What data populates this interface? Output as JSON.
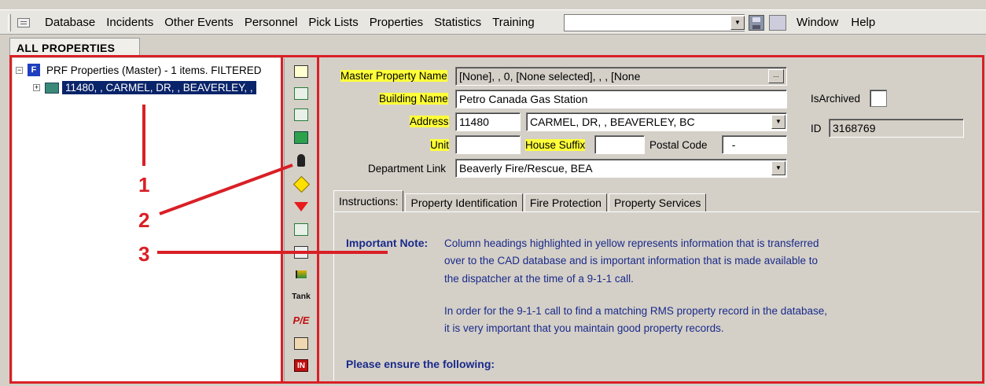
{
  "menubar": {
    "items": [
      "Database",
      "Incidents",
      "Other Events",
      "Personnel",
      "Pick Lists",
      "Properties",
      "Statistics",
      "Training"
    ],
    "combo_value": "",
    "right_items": [
      "Window",
      "Help"
    ]
  },
  "tab": {
    "label": "ALL PROPERTIES"
  },
  "tree": {
    "root_label": "PRF  Properties (Master) - 1 items. FILTERED",
    "child_label": "11480, , CARMEL, DR, , BEAVERLEY, ,"
  },
  "toolbar": {
    "tools": [
      {
        "name": "up-folder-icon"
      },
      {
        "name": "green-building-up-icon"
      },
      {
        "name": "green-building-down-icon"
      },
      {
        "name": "green-house-icon"
      },
      {
        "name": "person-icon"
      },
      {
        "name": "hydrant-diamond-icon"
      },
      {
        "name": "red-triangle-icon"
      },
      {
        "name": "al-box-icon"
      },
      {
        "name": "document-icon"
      },
      {
        "name": "flag-icon"
      },
      {
        "name": "tank-icon",
        "label": "Tank"
      },
      {
        "name": "pe-icon",
        "label": "P/E"
      },
      {
        "name": "book-icon"
      },
      {
        "name": "in-icon",
        "label": "IN"
      }
    ]
  },
  "annotations": {
    "one": "1",
    "two": "2",
    "three": "3"
  },
  "form": {
    "master_property_label": "Master Property Name",
    "master_property_value": "[None], , 0, [None selected], , , [None",
    "building_name_label": "Building Name",
    "building_name_value": "Petro Canada Gas Station",
    "address_label": "Address",
    "address_number": "11480",
    "address_street": "CARMEL, DR, , BEAVERLEY, BC",
    "unit_label": "Unit",
    "unit_value": "",
    "house_suffix_label": "House Suffix",
    "house_suffix_value": "",
    "postal_code_label": "Postal Code",
    "postal_code_value": "  -",
    "department_link_label": "Department Link",
    "department_link_value": "Beaverly Fire/Rescue, BEA",
    "is_archived_label": "IsArchived",
    "id_label": "ID",
    "id_value": "3168769"
  },
  "inner_tabs": [
    "Instructions:",
    "Property Identification",
    "Fire Protection",
    "Property Services"
  ],
  "instructions": {
    "heading": "Important Note:",
    "lines": [
      "Column headings highlighted in yellow represents information that is transferred",
      "over to the CAD database and is important information that is made available to",
      "the dispatcher at the time of a 9-1-1 call.",
      "In order for the 9-1-1 call to find a matching RMS property record in the database,",
      "it is very important that you maintain good property records."
    ],
    "ensure": "Please ensure the following:"
  },
  "colors": {
    "annotation_red": "#d91f26",
    "highlight_yellow": "#ffff3a",
    "selection_blue": "#0a246a",
    "note_blue": "#1a2a8a"
  }
}
